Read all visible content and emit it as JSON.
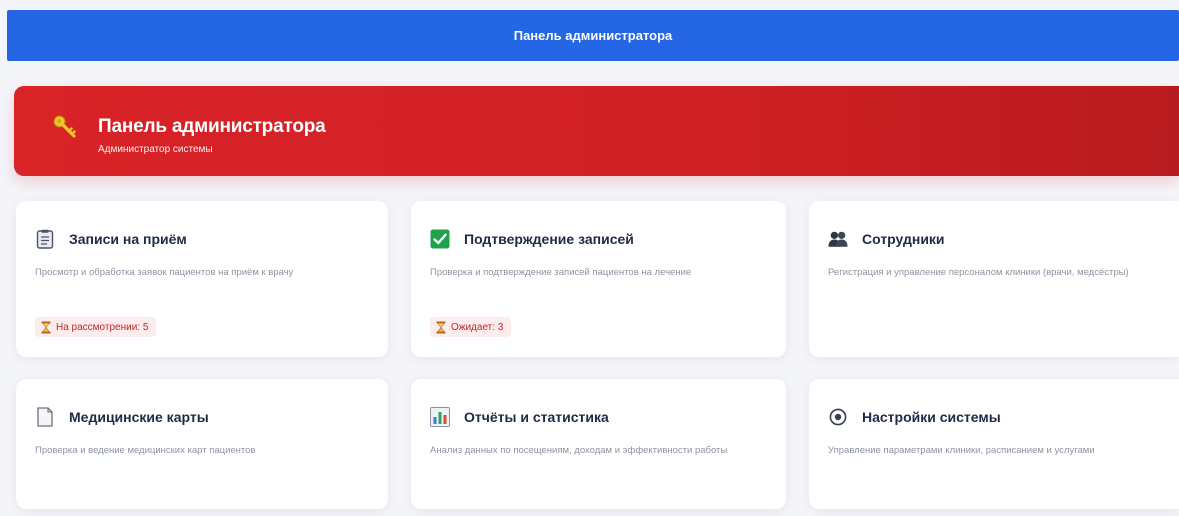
{
  "topbar": {
    "title": "Панель администратора"
  },
  "hero": {
    "icon": "key-icon",
    "title": "Панель администратора",
    "subtitle": "Администратор системы"
  },
  "cards": [
    {
      "icon": "clipboard-icon",
      "title": "Записи на приём",
      "description": "Просмотр и обработка заявок пациентов на приём к врачу",
      "badge": "На рассмотрении: 5"
    },
    {
      "icon": "check-icon",
      "title": "Подтверждение записей",
      "description": "Проверка и подтверждение записей пациентов на лечение",
      "badge": "Ожидает: 3"
    },
    {
      "icon": "people-icon",
      "title": "Сотрудники",
      "description": "Регистрация и управление персоналом клиники (врачи, медсёстры)"
    },
    {
      "icon": "document-icon",
      "title": "Медицинские карты",
      "description": "Проверка и ведение медицинских карт пациентов"
    },
    {
      "icon": "bar-chart-icon",
      "title": "Отчёты и статистика",
      "description": "Анализ данных по посещениям, доходам и эффективности работы"
    },
    {
      "icon": "settings-icon",
      "title": "Настройки системы",
      "description": "Управление параметрами клиники, расписанием и услугами"
    }
  ],
  "colors": {
    "topbar": "#2466e4",
    "hero": "#d82327",
    "badge_bg": "#fdecec",
    "badge_text": "#c0282c",
    "check_green": "#1fa34a"
  }
}
